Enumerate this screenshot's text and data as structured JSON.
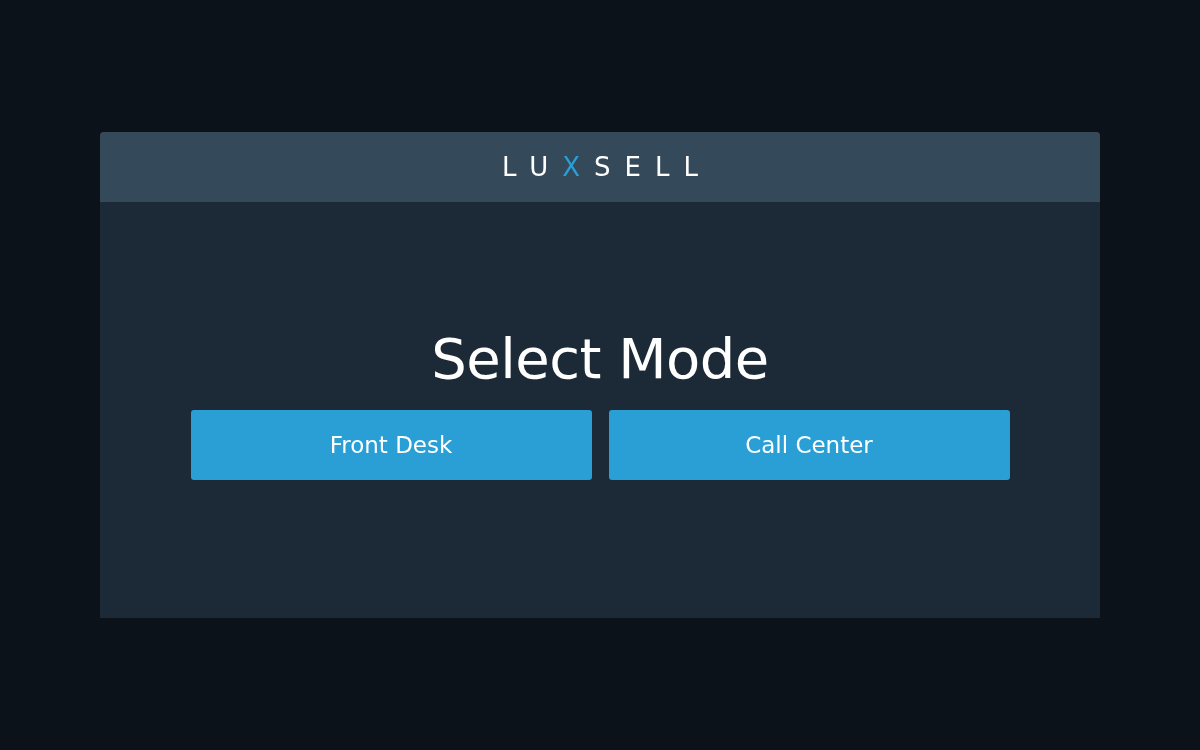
{
  "header": {
    "logo": [
      {
        "text": "LU",
        "color": "#ffffff"
      },
      {
        "text": "X",
        "color": "#2a9fd6"
      },
      {
        "text": "SELL",
        "color": "#ffffff"
      }
    ]
  },
  "title": "Select Mode",
  "buttons": [
    {
      "label": "Front Desk"
    },
    {
      "label": "Call Center"
    }
  ]
}
